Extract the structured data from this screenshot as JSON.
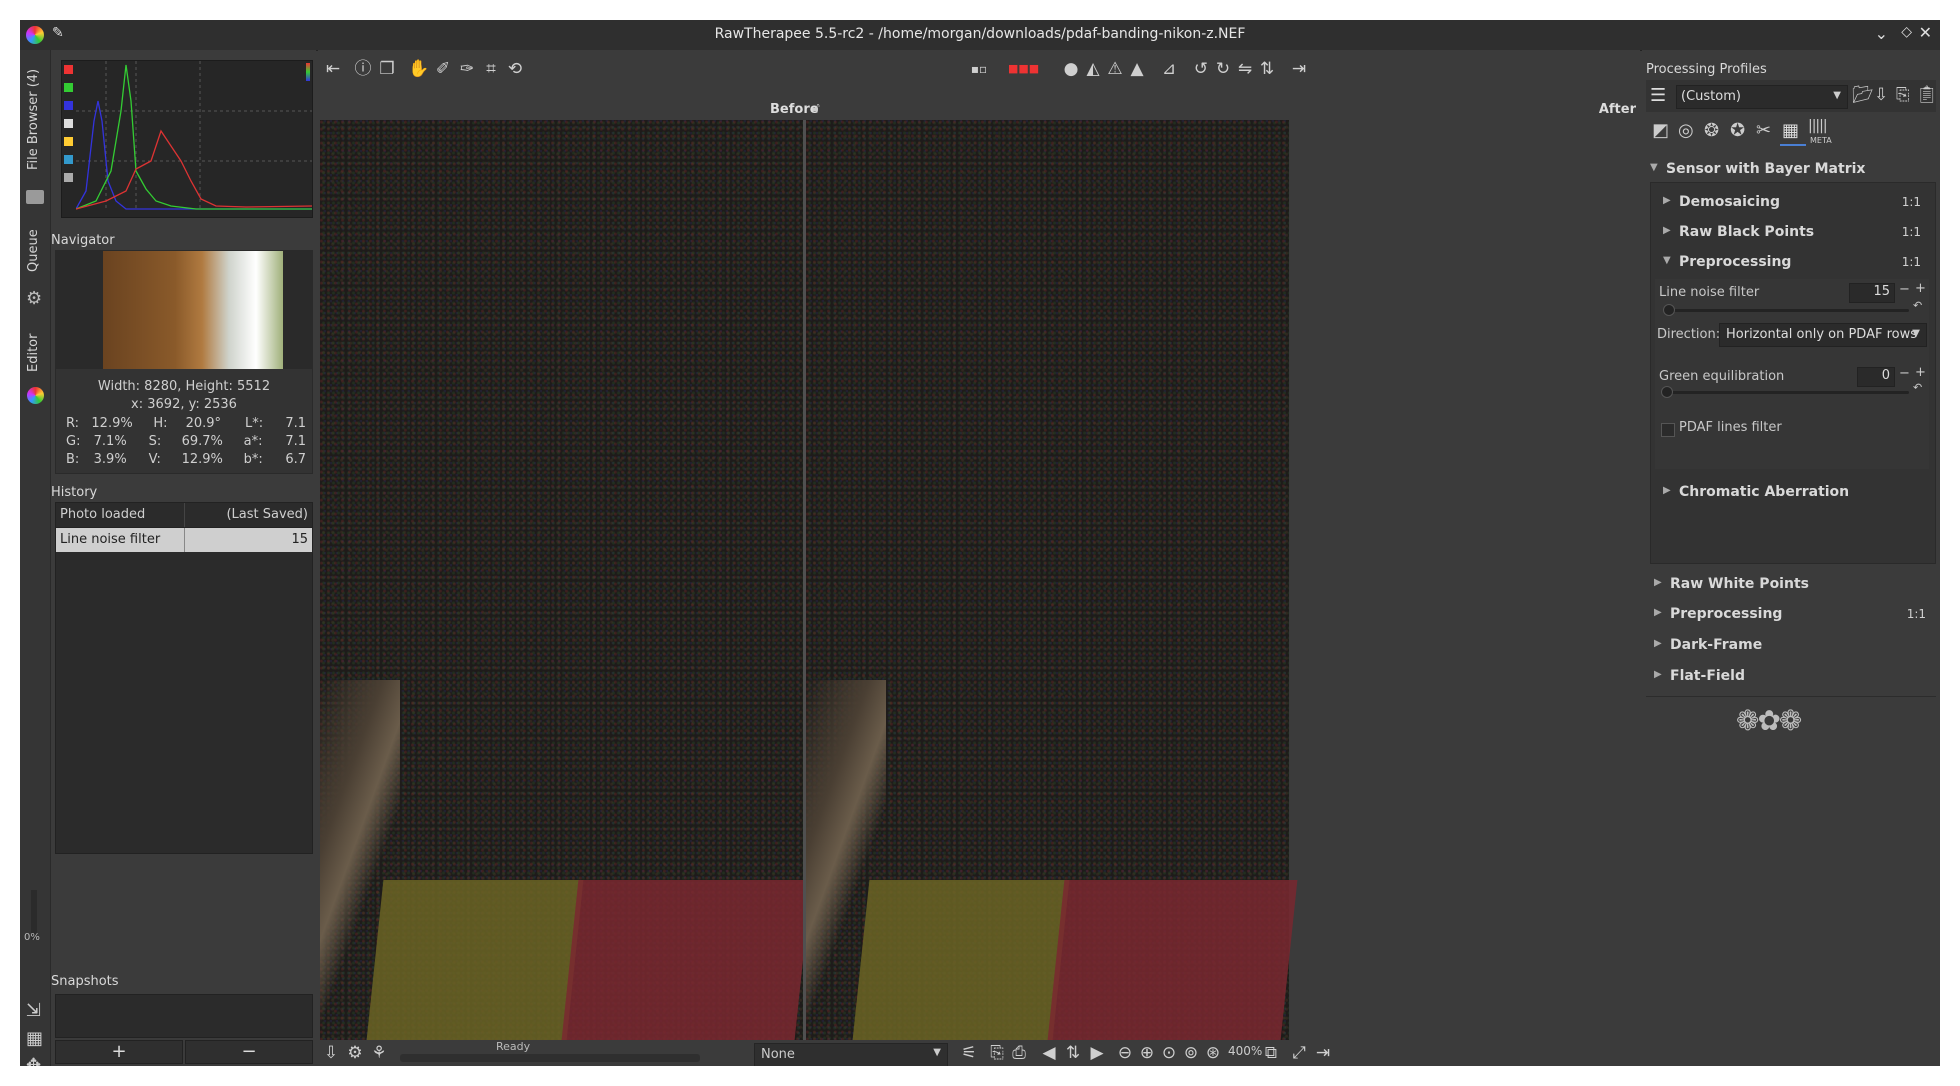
{
  "window": {
    "title": "RawTherapee 5.5-rc2 - /home/morgan/downloads/pdaf-banding-nikon-z.NEF"
  },
  "left_tabs": {
    "file_browser": "File Browser (4)",
    "queue": "Queue",
    "editor": "Editor",
    "progress": "0%"
  },
  "navigator": {
    "title": "Navigator",
    "dimensions": "Width: 8280, Height: 5512",
    "coords": "x: 3692, y: 2536",
    "rows": [
      {
        "k1": "R:",
        "v1": "12.9%",
        "k2": "H:",
        "v2": "20.9°",
        "k3": "L*:",
        "v3": "7.1"
      },
      {
        "k1": "G:",
        "v1": "7.1%",
        "k2": "S:",
        "v2": "69.7%",
        "k3": "a*:",
        "v3": "7.1"
      },
      {
        "k1": "B:",
        "v1": "3.9%",
        "k2": "V:",
        "v2": "12.9%",
        "k3": "b*:",
        "v3": "6.7"
      }
    ]
  },
  "history": {
    "title": "History",
    "rows": [
      {
        "label": "Photo loaded",
        "value": "(Last Saved)"
      },
      {
        "label": "Line noise filter",
        "value": "15"
      }
    ]
  },
  "snapshots": {
    "title": "Snapshots",
    "add": "+",
    "remove": "−"
  },
  "preview": {
    "before": "Before",
    "after": "After",
    "status": "Ready",
    "zoom": "400%",
    "profile_select": "None"
  },
  "right_panel": {
    "profiles_title": "Processing Profiles",
    "profile_value": "(Custom)",
    "meta_label": "META",
    "section": "Sensor with Bayer Matrix",
    "tools": [
      {
        "label": "Demosaicing",
        "badge": "1:1"
      },
      {
        "label": "Raw Black Points",
        "badge": "1:1"
      },
      {
        "label": "Preprocessing",
        "badge": "1:1"
      }
    ],
    "line_noise": {
      "label": "Line noise filter",
      "value": "15"
    },
    "direction": {
      "label": "Direction:",
      "value": "Horizontal only on PDAF rows"
    },
    "green_eq": {
      "label": "Green equilibration",
      "value": "0"
    },
    "pdaf_lines": "PDAF lines filter",
    "chromatic": "Chromatic Aberration",
    "outer_tools": [
      {
        "label": "Raw White Points",
        "badge": ""
      },
      {
        "label": "Preprocessing",
        "badge": "1:1"
      },
      {
        "label": "Dark-Frame",
        "badge": ""
      },
      {
        "label": "Flat-Field",
        "badge": ""
      }
    ]
  },
  "colors": {
    "window_bg": "#3b3b3b",
    "panel_bg": "#333333",
    "accent_blue": "#4a7fd4"
  }
}
